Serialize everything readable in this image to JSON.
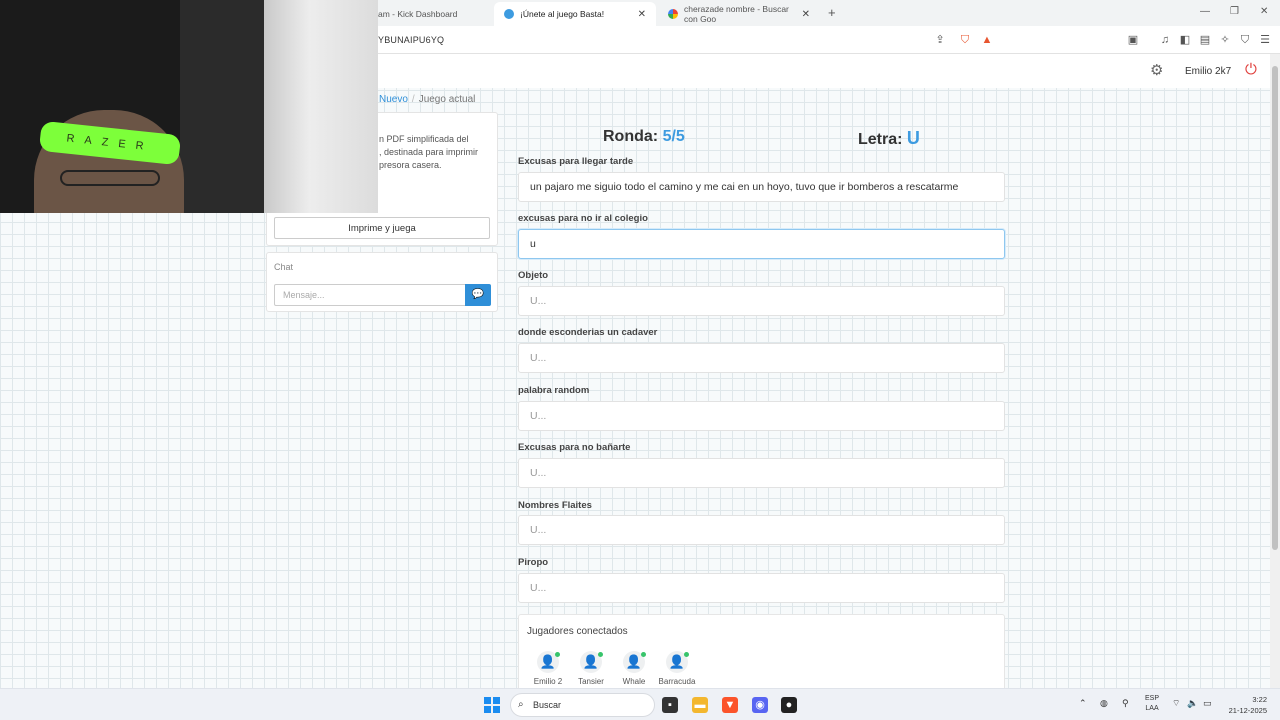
{
  "browser": {
    "tabs": [
      {
        "label": "am - Kick Dashboard",
        "active": false
      },
      {
        "label": "¡Únete al juego Basta!",
        "active": true
      },
      {
        "label": "cherazade nombre - Buscar con Goo",
        "active": false
      }
    ],
    "url": "YBUNAIPU6YQ"
  },
  "header": {
    "username": "Emilio 2k7"
  },
  "breadcrumb": {
    "new": "Nuevo",
    "current": "Juego actual"
  },
  "left_panel": {
    "pdf_lines": [
      "n PDF simplificada del",
      ", destinada para imprimir",
      "presora casera."
    ],
    "print_button": "Imprime y juega",
    "chat_title": "Chat",
    "chat_placeholder": "Mensaje..."
  },
  "game": {
    "round_label": "Ronda:",
    "round_value": "5/5",
    "letter_label": "Letra:",
    "letter_value": "U",
    "fields": [
      {
        "label": "Excusas para llegar tarde",
        "value": "un pajaro me siguio todo el camino y me cai en un hoyo, tuvo que ir bomberos a rescatarme",
        "placeholder": "U..."
      },
      {
        "label": "excusas para no ir al colegio",
        "value": "u",
        "placeholder": "U..."
      },
      {
        "label": "Objeto",
        "value": "",
        "placeholder": "U..."
      },
      {
        "label": "donde esconderias un cadaver",
        "value": "",
        "placeholder": "U..."
      },
      {
        "label": "palabra random",
        "value": "",
        "placeholder": "U..."
      },
      {
        "label": "Excusas para no bañarte",
        "value": "",
        "placeholder": "U..."
      },
      {
        "label": "Nombres Flaites",
        "value": "",
        "placeholder": "U..."
      },
      {
        "label": "Piropo",
        "value": "",
        "placeholder": "U..."
      }
    ],
    "players_title": "Jugadores conectados",
    "players": [
      "Emilio 2",
      "Tansier",
      "Whale",
      "Barracuda"
    ]
  },
  "webcam": {
    "headband_text": "RAZER"
  },
  "taskbar": {
    "search_placeholder": "Buscar",
    "lang_top": "ESP",
    "lang_bottom": "LAA",
    "time": "3:22",
    "date": "21-12-2025"
  },
  "colors": {
    "accent": "#3d9be0",
    "online": "#38c46b",
    "power": "#e0413e"
  }
}
